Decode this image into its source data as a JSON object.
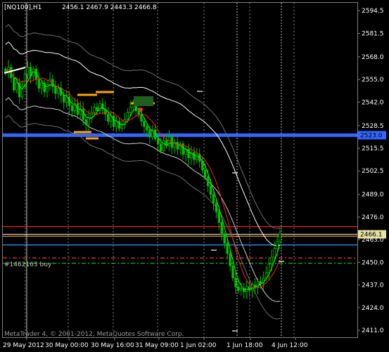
{
  "header": {
    "symbol_tf": "[NQ100],H1",
    "ohlc": "2456.1 2467.9 2443.3 2466.8"
  },
  "footer": {
    "copyright": "MetaTrader 4, © 2001-2012, MetaQuotes Software Corp."
  },
  "order_label": "#1462163 buy",
  "colors": {
    "background": "#000000",
    "grid": "#8a8a8a",
    "bull_candle": "#00c000",
    "bear_candle": "#00c000",
    "ma_red": "#ff2020",
    "ma_green": "#00ff00",
    "envelope": "#ffffff",
    "blue_level": "#3366ff",
    "order_line": "#ff8c00",
    "orange_marks": "#ffa500"
  },
  "chart_data": {
    "type": "candlestick",
    "title": "[NQ100],H1",
    "y_ticks": [
      2594.5,
      2581.5,
      2568.0,
      2555.0,
      2542.0,
      2528.5,
      2515.5,
      2502.5,
      2489.0,
      2476.0,
      2463.0,
      2450.0,
      2437.0,
      2424.0,
      2411.0
    ],
    "ylim": [
      2407.0,
      2599.0
    ],
    "x_labels": [
      "29 May 2012",
      "30 May 00:00",
      "30 May 16:00",
      "31 May 09:00",
      "1 Jun 02:00",
      "1 Jun 18:00",
      "4 Jun 12:00"
    ],
    "price_labels": [
      {
        "value": 2523.0,
        "text": "2523.0",
        "color": "#3366ff"
      },
      {
        "value": 2466.1,
        "text": "2466.1",
        "color": "#ffffff"
      }
    ],
    "levels": [
      {
        "value": 2523.0,
        "color": "#3366ff",
        "style": "solid",
        "name": "blue-resistance"
      },
      {
        "value": 2470.5,
        "color": "#ff2020",
        "style": "solid",
        "name": "red-level"
      },
      {
        "value": 2466.1,
        "color": "#c8c8c8",
        "style": "solid",
        "name": "bid-level"
      },
      {
        "value": 2465.0,
        "color": "#ffa500",
        "style": "solid",
        "name": "orange-level"
      },
      {
        "value": 2460.0,
        "color": "#3399ff",
        "style": "solid",
        "name": "blue-support"
      },
      {
        "value": 2452.5,
        "color": "#ff4040",
        "style": "dashdot",
        "name": "stop-level"
      },
      {
        "value": 2449.5,
        "color": "#00c000",
        "style": "dashdot",
        "name": "order-level"
      }
    ],
    "closes": [
      2559,
      2562,
      2556,
      2549,
      2553,
      2545,
      2551,
      2558,
      2562,
      2557,
      2561,
      2555,
      2550,
      2553,
      2548,
      2552,
      2555,
      2551,
      2547,
      2550,
      2546,
      2542,
      2545,
      2540,
      2537,
      2541,
      2535,
      2538,
      2532,
      2529,
      2533,
      2536,
      2539,
      2537,
      2541,
      2538,
      2535,
      2531,
      2534,
      2528,
      2531,
      2527,
      2529,
      2532,
      2536,
      2539,
      2541,
      2537,
      2535,
      2531,
      2528,
      2526,
      2522,
      2526,
      2521,
      2518,
      2514,
      2520,
      2517,
      2522,
      2516,
      2519,
      2515,
      2518,
      2512,
      2515,
      2510,
      2513,
      2509,
      2512,
      2508,
      2503,
      2499,
      2494,
      2489,
      2484,
      2479,
      2473,
      2466,
      2461,
      2455,
      2448,
      2441,
      2436,
      2434,
      2435,
      2433,
      2436,
      2434,
      2437,
      2436,
      2439,
      2438,
      2441,
      2444,
      2449,
      2453,
      2458,
      2462,
      2466.8
    ]
  }
}
